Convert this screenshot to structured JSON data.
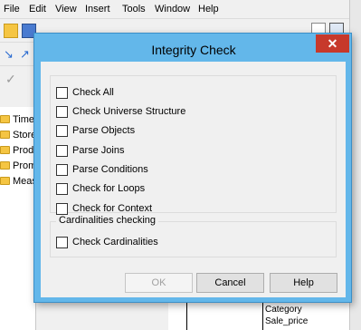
{
  "menubar": {
    "items": [
      "File",
      "Edit",
      "View",
      "Insert",
      "Tools",
      "Window",
      "Help"
    ]
  },
  "tree": {
    "items": [
      "Time",
      "Store",
      "Produ",
      "Prom",
      "Meas"
    ]
  },
  "canvas": {
    "table_rows": [
      "Category",
      "Sale_price"
    ]
  },
  "dialog": {
    "title": "Integrity Check",
    "close_glyph": "✕",
    "checks": [
      "Check All",
      "Check Universe Structure",
      "Parse Objects",
      "Parse Joins",
      "Parse Conditions",
      "Check for Loops",
      "Check for Context"
    ],
    "cardinalities": {
      "group_label": "Cardinalities checking",
      "check": "Check Cardinalities"
    },
    "buttons": {
      "ok": "OK",
      "cancel": "Cancel",
      "help": "Help"
    }
  },
  "colors": {
    "title_bar": "#63b7ea",
    "close_button": "#c7392b",
    "dialog_body": "#f0f0f0"
  }
}
